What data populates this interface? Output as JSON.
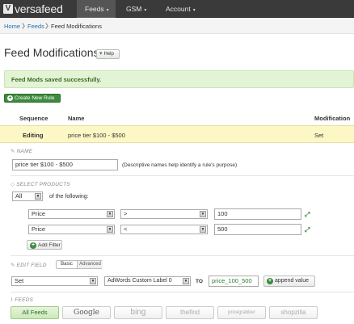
{
  "brand": {
    "mark": "V",
    "name": "versafeed"
  },
  "nav": {
    "items": [
      {
        "label": "Feeds",
        "caret": "▾"
      },
      {
        "label": "GSM",
        "caret": "▾"
      },
      {
        "label": "Account",
        "caret": "▾"
      }
    ]
  },
  "breadcrumb": {
    "items": [
      "Home",
      "Feeds",
      "Feed Modifications"
    ],
    "separator": "❯"
  },
  "page": {
    "title": "Feed Modifications",
    "help_label": "Help"
  },
  "alert": {
    "message": "Feed Mods saved successfully."
  },
  "create_rule": {
    "label": "Create New Rule",
    "icon": "+"
  },
  "table": {
    "headers": {
      "sequence": "Sequence",
      "name": "Name",
      "modification": "Modification"
    },
    "rows": [
      {
        "sequence": "Editing",
        "name": "price tier $100 - $500",
        "modification": "Set"
      }
    ]
  },
  "name_section": {
    "label": "NAME",
    "value": "price tier $100 - $500",
    "hint": "(Descriptive names help identify a rule's purpose)"
  },
  "select_products": {
    "label": "SELECT PRODUCTS",
    "match": "All",
    "match_suffix": "of the following:",
    "filters": [
      {
        "field": "Price",
        "operator": ">",
        "value": "100"
      },
      {
        "field": "Price",
        "operator": "<",
        "value": "500"
      }
    ],
    "add_filter_label": "Add Filter"
  },
  "edit_field": {
    "label": "EDIT FIELD",
    "tabs": {
      "basic": "Basic",
      "advanced": "Advanced"
    },
    "action": "Set",
    "field": "AdWords Custom Label 0",
    "to_label": "TO",
    "value": "price_100_500",
    "append_label": "append value"
  },
  "feeds": {
    "label": "FEEDS",
    "items": [
      "All Feeds",
      "Google",
      "bing",
      "thefind",
      "pricegrabber",
      "shopzilla"
    ]
  },
  "colors": {
    "accent_green": "#3e8a3e",
    "nav_bg": "#3a3a3a",
    "alert_bg": "#e3f3d6",
    "selected_row": "#fdf7c6",
    "link": "#1f6fb3"
  }
}
